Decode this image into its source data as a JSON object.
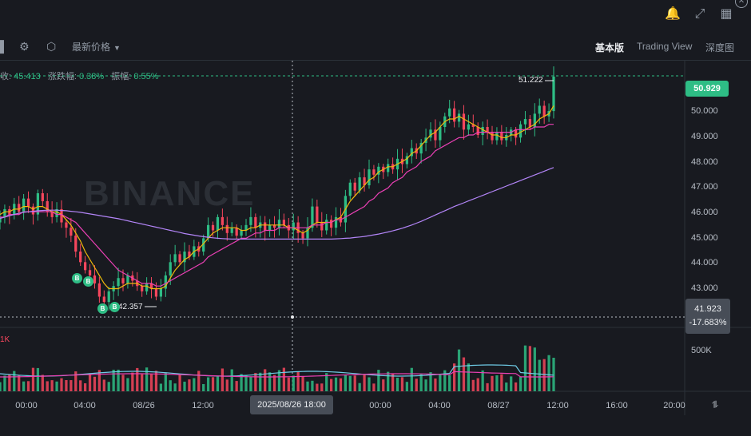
{
  "topbar": {
    "bell_icon": "bell-icon",
    "expand_icon": "expand-icon",
    "layout_icon": "layout-icon",
    "close_icon": "close-icon"
  },
  "toolbar": {
    "price_type": "最新价格",
    "tabs": [
      "基本版",
      "Trading View",
      "深度图"
    ],
    "active_tab": "基本版"
  },
  "info": {
    "close_suffix": "收:",
    "close_value": "45.413",
    "change_label": "涨跌幅:",
    "change_value": "0.38%",
    "amplitude_label": "振幅:",
    "amplitude_value": "0.55%"
  },
  "watermark": "BINANCE",
  "price_axis": [
    "50.000",
    "49.000",
    "48.000",
    "47.000",
    "46.000",
    "45.000",
    "44.000",
    "43.000"
  ],
  "current_price": "50.929",
  "crosshair": {
    "price": "41.923",
    "percent": "-17.683%",
    "date": "2025/08/26 18:00"
  },
  "max_marker": "51.222",
  "min_marker": "42.357",
  "volume_axis": "500K",
  "volume_label": "1K",
  "time_axis": [
    "00:00",
    "04:00",
    "08/26",
    "12:00",
    "00:00",
    "04:00",
    "08/27",
    "12:00",
    "16:00",
    "20:00"
  ],
  "buy_marker_label": "B",
  "colors": {
    "up": "#2ebd85",
    "down": "#f6465d",
    "ma7": "#f0b90b",
    "ma25": "#eb40b5",
    "ma99": "#b385f8",
    "background": "#181a20"
  },
  "chart_data": {
    "type": "candlestick",
    "x_start": "2025/08/25 22:00",
    "x_end": "2025/08/27 12:00",
    "ylim": [
      41.5,
      51.5
    ],
    "closes": [
      45.6,
      45.9,
      45.7,
      46.1,
      45.8,
      46.3,
      46.0,
      45.7,
      46.5,
      46.2,
      45.8,
      45.6,
      45.9,
      45.4,
      45.2,
      44.9,
      44.3,
      43.9,
      43.6,
      43.4,
      43.1,
      42.6,
      42.4,
      42.8,
      43.0,
      43.3,
      43.1,
      43.4,
      43.2,
      43.0,
      42.8,
      43.1,
      42.9,
      42.6,
      42.9,
      43.4,
      43.9,
      44.2,
      43.9,
      44.3,
      44.1,
      44.5,
      44.3,
      44.8,
      45.3,
      45.1,
      45.6,
      45.3,
      45.0,
      45.2,
      44.9,
      45.1,
      45.3,
      45.6,
      45.2,
      45.4,
      45.1,
      45.3,
      45.2,
      45.5,
      45.3,
      45.1,
      45.4,
      45.0,
      44.8,
      45.2,
      46.0,
      45.4,
      45.1,
      45.5,
      45.2,
      45.6,
      45.4,
      46.4,
      46.9,
      46.6,
      47.1,
      46.8,
      47.4,
      47.2,
      47.5,
      47.3,
      47.6,
      47.4,
      47.8,
      47.6,
      47.9,
      48.2,
      48.0,
      48.4,
      48.6,
      48.9,
      48.5,
      49.0,
      49.4,
      49.7,
      49.2,
      49.5,
      48.9,
      49.1,
      49.0,
      48.7,
      49.0,
      48.8,
      48.5,
      48.8,
      48.5,
      48.7,
      48.9,
      48.6,
      49.1,
      49.3,
      49.0,
      49.5,
      49.8,
      49.4,
      49.6,
      50.9
    ],
    "series": [
      {
        "name": "MA7",
        "values": [
          45.7,
          45.8,
          45.8,
          45.9,
          45.9,
          46.0,
          46.0,
          45.9,
          46.0,
          46.0,
          45.9,
          45.8,
          45.8,
          45.7,
          45.5,
          45.3,
          45.0,
          44.7,
          44.3,
          44.0,
          43.7,
          43.4,
          43.1,
          42.9,
          42.9,
          42.9,
          43.0,
          43.1,
          43.1,
          43.1,
          43.0,
          43.0,
          42.9,
          42.9,
          42.9,
          43.0,
          43.3,
          43.6,
          43.8,
          44.0,
          44.1,
          44.3,
          44.4,
          44.6,
          44.8,
          45.0,
          45.1,
          45.2,
          45.2,
          45.2,
          45.2,
          45.1,
          45.1,
          45.2,
          45.2,
          45.3,
          45.3,
          45.3,
          45.3,
          45.3,
          45.3,
          45.2,
          45.2,
          45.1,
          45.0,
          45.1,
          45.3,
          45.4,
          45.4,
          45.4,
          45.4,
          45.5,
          45.6,
          45.9,
          46.2,
          46.4,
          46.6,
          46.8,
          47.0,
          47.1,
          47.3,
          47.4,
          47.5,
          47.5,
          47.6,
          47.7,
          47.8,
          48.0,
          48.1,
          48.3,
          48.5,
          48.7,
          48.8,
          49.0,
          49.2,
          49.3,
          49.3,
          49.4,
          49.3,
          49.2,
          49.1,
          49.0,
          48.9,
          48.8,
          48.7,
          48.7,
          48.6,
          48.6,
          48.7,
          48.7,
          48.8,
          48.9,
          49.0,
          49.1,
          49.3,
          49.4,
          49.5,
          49.8
        ]
      },
      {
        "name": "MA25",
        "values": [
          45.6,
          45.6,
          45.7,
          45.7,
          45.7,
          45.8,
          45.8,
          45.8,
          45.8,
          45.8,
          45.8,
          45.8,
          45.7,
          45.7,
          45.6,
          45.5,
          45.4,
          45.2,
          45.0,
          44.8,
          44.6,
          44.4,
          44.2,
          44.0,
          43.8,
          43.6,
          43.5,
          43.4,
          43.3,
          43.2,
          43.1,
          43.1,
          43.1,
          43.0,
          43.0,
          43.1,
          43.2,
          43.3,
          43.4,
          43.5,
          43.6,
          43.7,
          43.8,
          43.9,
          44.1,
          44.2,
          44.3,
          44.4,
          44.5,
          44.6,
          44.7,
          44.8,
          44.8,
          44.9,
          45.0,
          45.0,
          45.1,
          45.1,
          45.1,
          45.2,
          45.2,
          45.2,
          45.2,
          45.2,
          45.2,
          45.2,
          45.3,
          45.3,
          45.3,
          45.4,
          45.4,
          45.5,
          45.5,
          45.6,
          45.7,
          45.8,
          45.9,
          46.0,
          46.2,
          46.3,
          46.5,
          46.6,
          46.7,
          46.9,
          47.0,
          47.1,
          47.3,
          47.4,
          47.5,
          47.7,
          47.8,
          47.9,
          48.1,
          48.2,
          48.3,
          48.4,
          48.5,
          48.6,
          48.6,
          48.7,
          48.7,
          48.8,
          48.8,
          48.8,
          48.8,
          48.8,
          48.8,
          48.8,
          48.8,
          48.9,
          48.9,
          48.9,
          48.9,
          49.0,
          49.0,
          49.0,
          49.1,
          49.1
        ]
      },
      {
        "name": "MA99",
        "values": [
          45.55,
          45.6,
          45.65,
          45.7,
          45.75,
          45.78,
          45.8,
          45.82,
          45.84,
          45.85,
          45.86,
          45.86,
          45.86,
          45.85,
          45.84,
          45.82,
          45.8,
          45.78,
          45.75,
          45.72,
          45.69,
          45.66,
          45.63,
          45.6,
          45.57,
          45.54,
          45.5,
          45.46,
          45.42,
          45.38,
          45.34,
          45.3,
          45.26,
          45.22,
          45.18,
          45.14,
          45.1,
          45.06,
          45.02,
          44.98,
          44.95,
          44.92,
          44.89,
          44.86,
          44.84,
          44.82,
          44.8,
          44.79,
          44.78,
          44.77,
          44.77,
          44.77,
          44.77,
          44.77,
          44.77,
          44.77,
          44.77,
          44.77,
          44.77,
          44.77,
          44.77,
          44.77,
          44.77,
          44.77,
          44.77,
          44.77,
          44.77,
          44.77,
          44.77,
          44.77,
          44.77,
          44.78,
          44.79,
          44.8,
          44.81,
          44.83,
          44.85,
          44.87,
          44.9,
          44.93,
          44.96,
          45.0,
          45.04,
          45.08,
          45.13,
          45.18,
          45.24,
          45.3,
          45.37,
          45.44,
          45.52,
          45.6,
          45.68,
          45.76,
          45.84,
          45.92,
          46.0,
          46.07,
          46.14,
          46.21,
          46.28,
          46.35,
          46.42,
          46.49,
          46.56,
          46.63,
          46.7,
          46.77,
          46.84,
          46.91,
          46.98,
          47.05,
          47.12,
          47.19,
          47.26,
          47.33,
          47.4,
          47.47
        ]
      }
    ]
  }
}
